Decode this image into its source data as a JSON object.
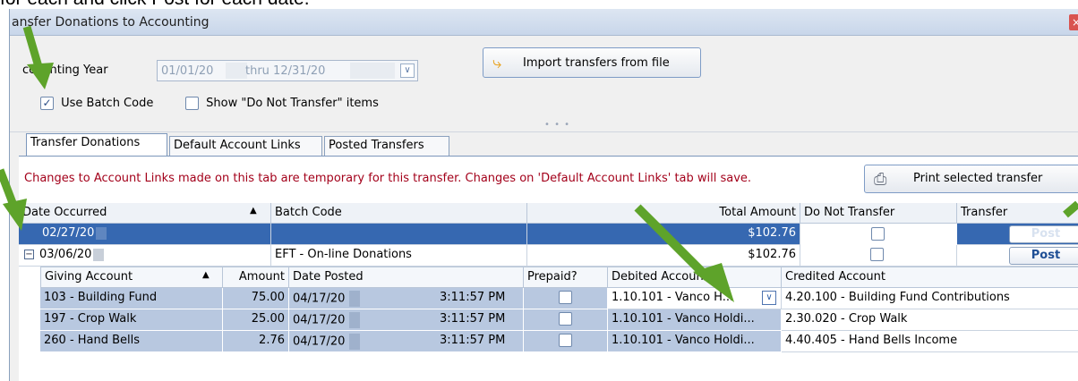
{
  "caption": "for each and click Post for each date.",
  "window": {
    "title": "ansfer Donations to Accounting",
    "close": "×"
  },
  "accounting_year": {
    "label": "ccounting Year",
    "from": "01/01/20",
    "thru": "thru 12/31/20",
    "dropdown_icon": "chevron-down-icon"
  },
  "import_button": {
    "label": "Import transfers from file"
  },
  "checkboxes": [
    {
      "label": "Use Batch Code",
      "checked": true
    },
    {
      "label": "Show \"Do Not Transfer\" items",
      "checked": false
    }
  ],
  "tabs": [
    {
      "label": "Transfer Donations",
      "active": true
    },
    {
      "label": "Default Account Links",
      "active": false
    },
    {
      "label": "Posted Transfers",
      "active": false
    }
  ],
  "notice": "Changes to Account Links made on this tab are temporary for this transfer. Changes on 'Default Account Links' tab will save.",
  "print_button": {
    "label": "Print selected transfer"
  },
  "grid": {
    "headers": {
      "date": "Date Occurred",
      "batch": "Batch Code",
      "total": "Total Amount",
      "dnt": "Do Not Transfer",
      "transfer": "Transfer"
    },
    "rows": [
      {
        "date": "02/27/20",
        "batch": "",
        "total": "$102.76",
        "post": "Post",
        "selected": true
      },
      {
        "date": "03/06/20",
        "batch": "EFT - On-line Donations",
        "total": "$102.76",
        "post": "Post",
        "selected": false,
        "expanded": true
      }
    ]
  },
  "subgrid": {
    "headers": {
      "account": "Giving Account",
      "amount": "Amount",
      "posted": "Date Posted",
      "prepaid": "Prepaid?",
      "debited": "Debited Account",
      "credited": "Credited Account"
    },
    "rows": [
      {
        "account": "103 - Building Fund",
        "amount": "75.00",
        "date": "04/17/20",
        "time": "3:11:57 PM",
        "debited": "1.10.101 - Vanco H...",
        "credited": "4.20.100 - Building Fund Contributions"
      },
      {
        "account": "197 - Crop Walk",
        "amount": "25.00",
        "date": "04/17/20",
        "time": "3:11:57 PM",
        "debited": "1.10.101 - Vanco Holdi...",
        "credited": "2.30.020 - Crop Walk"
      },
      {
        "account": "260 - Hand Bells",
        "amount": "2.76",
        "date": "04/17/20",
        "time": "3:11:57 PM",
        "debited": "1.10.101 - Vanco Holdi...",
        "credited": "4.40.405 - Hand Bells Income"
      }
    ]
  },
  "colors": {
    "selection": "#3668b1",
    "notice": "#a3001a",
    "arrow": "#5ea32a"
  }
}
